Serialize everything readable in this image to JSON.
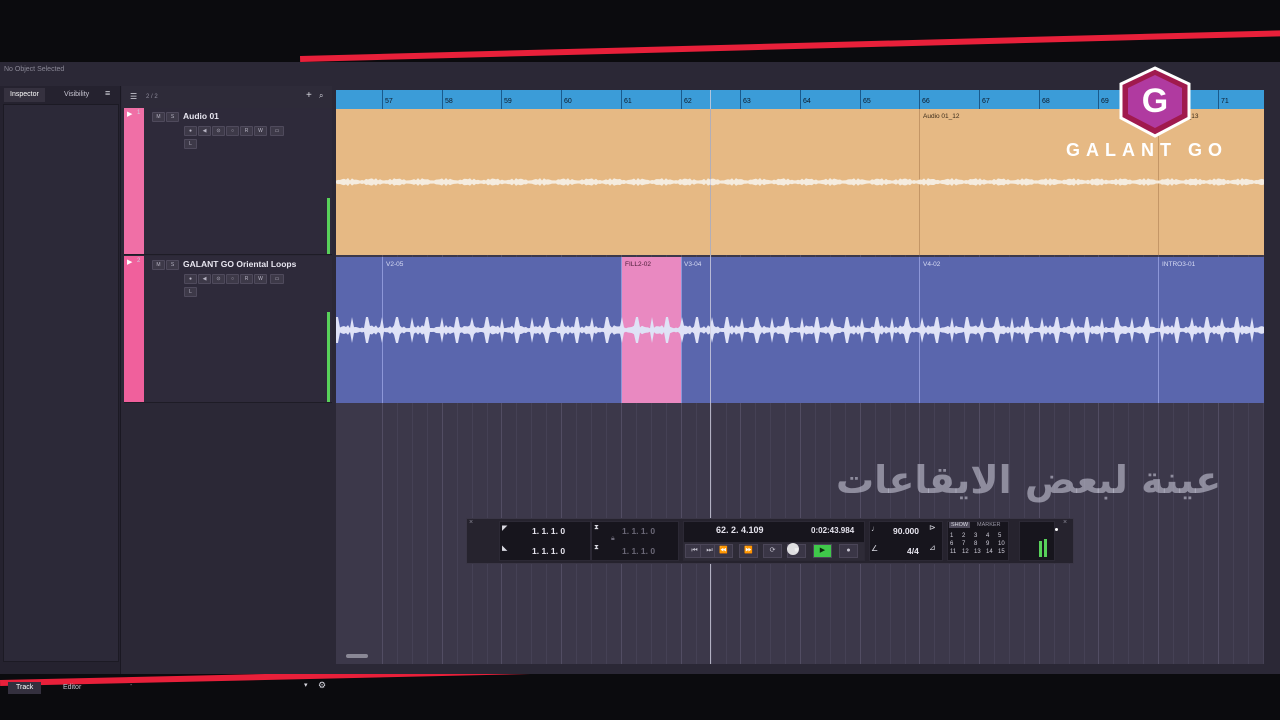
{
  "status": {
    "selection": "No Object Selected"
  },
  "inspector": {
    "tabs": [
      "Inspector",
      "Visibility"
    ],
    "bottom_tabs": [
      "Track",
      "Editor"
    ]
  },
  "tracklist": {
    "count": "2 / 2"
  },
  "tracks": [
    {
      "number": "1",
      "name": "Audio 01",
      "color": "#f06fa6"
    },
    {
      "number": "2",
      "name": "GALANT GO Oriental Loops",
      "color": "#f0609c"
    }
  ],
  "track_buttons": {
    "mute": "M",
    "solo": "S",
    "read": "R",
    "write": "W",
    "lane": "L"
  },
  "ruler": {
    "bars": [
      "57",
      "58",
      "59",
      "60",
      "61",
      "62",
      "63",
      "64",
      "65",
      "66",
      "67",
      "68",
      "69",
      "70",
      "71"
    ]
  },
  "events_audio": [
    {
      "label": "Audio 01_12"
    },
    {
      "label": "Audio 01_13"
    }
  ],
  "events_loops": [
    {
      "label": "V2-05"
    },
    {
      "label": "FILL2-02"
    },
    {
      "label": "V3-04"
    },
    {
      "label": "V4-02"
    },
    {
      "label": "INTRO3-01"
    }
  ],
  "transport": {
    "left_locator": "1. 1. 1. 0",
    "right_locator": "1. 1. 1. 0",
    "punch_in": "1. 1. 1. 0",
    "punch_out": "1. 1. 1. 0",
    "position_bars": "62. 2. 4.109",
    "position_time": "0:02:43.984",
    "tempo": "90.000",
    "signature": "4/4",
    "show_label": "SHOW",
    "marker_label": "MARKER",
    "markers": [
      "1",
      "2",
      "3",
      "4",
      "5",
      "6",
      "7",
      "8",
      "9",
      "10",
      "11",
      "12",
      "13",
      "14",
      "15"
    ]
  },
  "watermark": {
    "logo_letter": "G",
    "brand": "GALANT GO",
    "arabic_caption": "عينة لبعض الايقاعات"
  }
}
